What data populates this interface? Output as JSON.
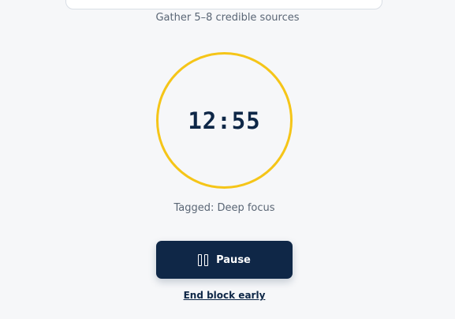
{
  "task": {
    "subtitle": "Gather 5–8 credible sources"
  },
  "timer": {
    "remaining": "12:55",
    "ring_color": "#f5c518"
  },
  "tag": {
    "text": "Tagged: Deep focus"
  },
  "controls": {
    "pause_label": "Pause",
    "pause_icon": "pause-icon",
    "end_label": "End block early"
  },
  "colors": {
    "primary": "#0f2747",
    "background": "#f6f7f9",
    "accent": "#f5c518",
    "muted_text": "#5a6675"
  }
}
